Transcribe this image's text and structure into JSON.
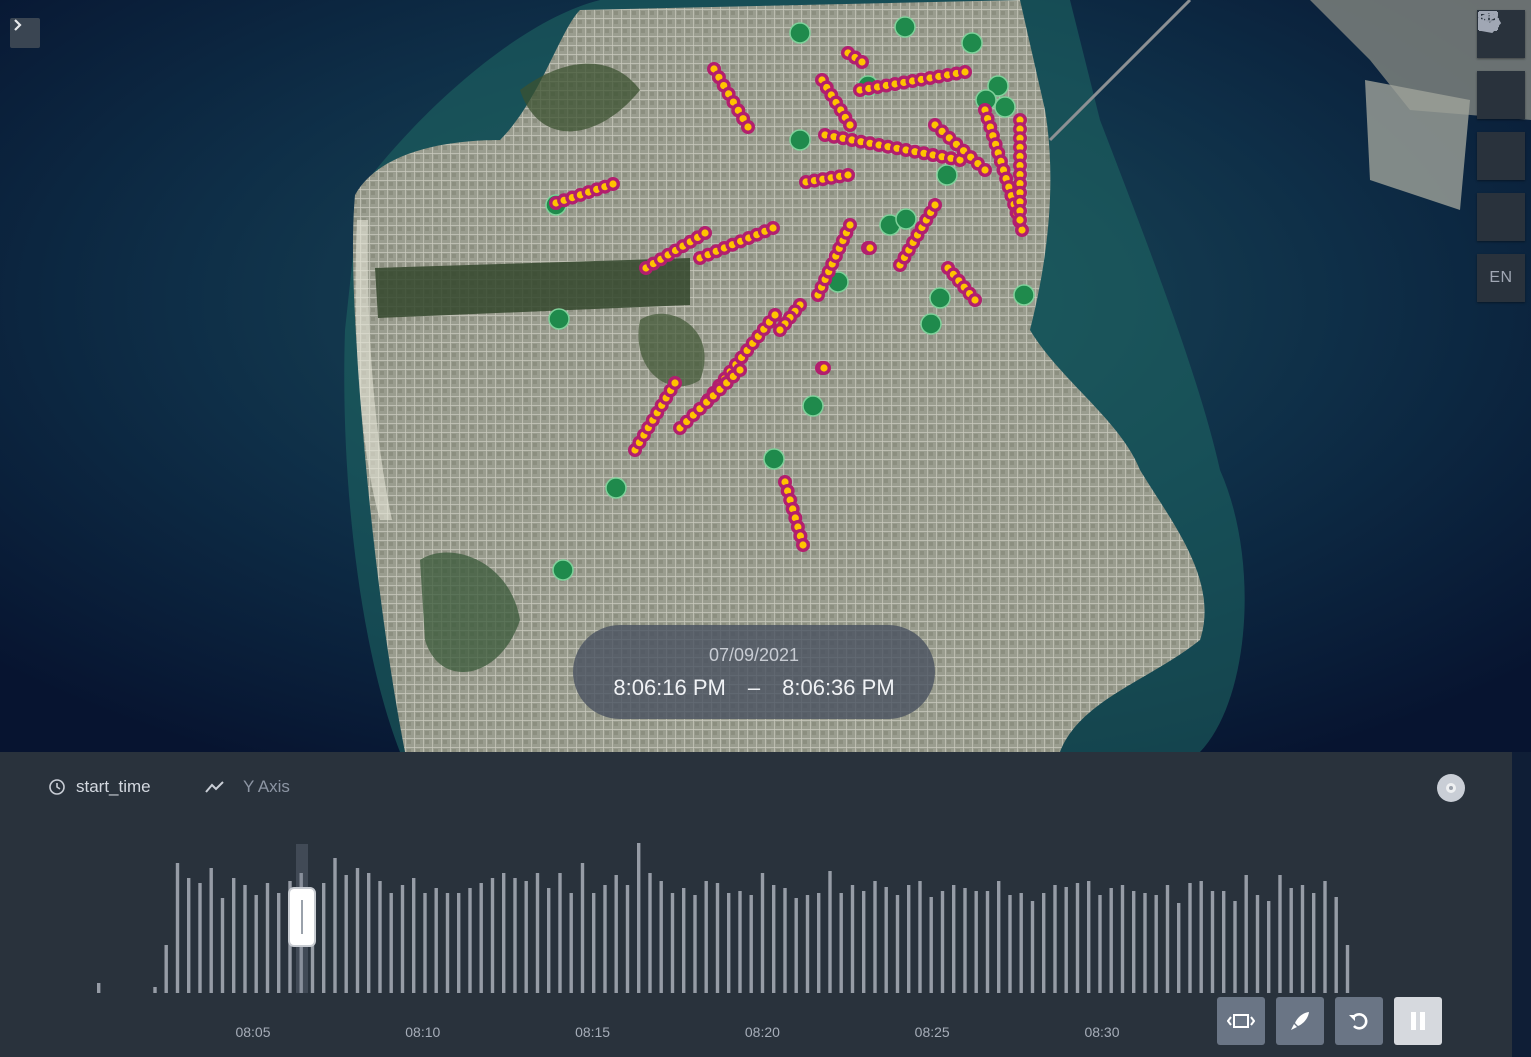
{
  "map": {
    "toggle_panel_icon": "chevron-right-icon",
    "controls": [
      {
        "name": "split-map-button",
        "icon": "split-map-icon"
      },
      {
        "name": "3d-map-button",
        "icon": "cube-icon"
      },
      {
        "name": "data-table-button",
        "icon": "table-icon"
      },
      {
        "name": "draw-polygon-button",
        "icon": "polygon-draw-icon"
      }
    ],
    "locale_label": "EN",
    "colors": {
      "trip_outer": "#b21f6e",
      "trip_inner": "#ffc300",
      "point": "#1f8a4c"
    }
  },
  "time_display": {
    "date": "07/09/2021",
    "start": "8:06:16 PM",
    "separator": "–",
    "end": "8:06:36 PM"
  },
  "timeline": {
    "field_label": "start_time",
    "field_icon": "clock-icon",
    "y_axis_label": "Y Axis",
    "y_axis_icon": "line-chart-icon",
    "settings_icon": "settings-icon",
    "tick_labels": [
      "08:05",
      "08:10",
      "08:15",
      "08:20",
      "08:25",
      "08:30"
    ],
    "window_fraction": 0.125,
    "controls": [
      {
        "name": "animation-window-button",
        "icon": "window-icon",
        "active": false
      },
      {
        "name": "speed-button",
        "icon": "rocket-icon",
        "active": false
      },
      {
        "name": "reset-button",
        "icon": "reset-icon",
        "active": false
      },
      {
        "name": "pause-button",
        "icon": "pause-icon",
        "active": true
      }
    ]
  }
}
